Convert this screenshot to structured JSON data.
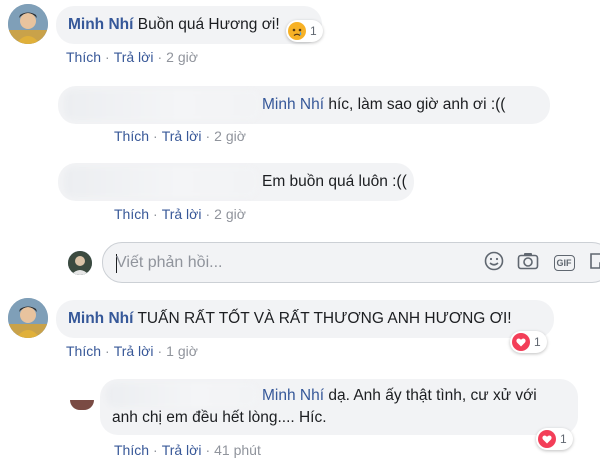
{
  "comments": [
    {
      "author": "Minh Nhí",
      "text": "Buồn quá Hương ơi!",
      "reaction_count": "1",
      "actions": {
        "like": "Thích",
        "reply": "Trả lời",
        "time": "2 giờ"
      }
    },
    {
      "author": "Minh Nhí",
      "text": "TUẤN RẤT TỐT VÀ RẤT THƯƠNG ANH HƯƠNG ƠI!",
      "reaction_count": "1",
      "actions": {
        "like": "Thích",
        "reply": "Trả lời",
        "time": "1 giờ"
      }
    }
  ],
  "replies": [
    {
      "tag": "Minh Nhí",
      "text": "híc, làm sao giờ anh ơi :((",
      "actions": {
        "like": "Thích",
        "reply": "Trả lời",
        "time": "2 giờ"
      }
    },
    {
      "text": "Em buồn quá luôn :((",
      "actions": {
        "like": "Thích",
        "reply": "Trả lời",
        "time": "2 giờ"
      }
    },
    {
      "tag": "Minh Nhí",
      "text_line1": "dạ. Anh ấy thật tình, cư xử với",
      "text_line2": "anh chị em đều hết lòng.... Híc.",
      "reaction_count": "1",
      "actions": {
        "like": "Thích",
        "reply": "Trả lời",
        "time": "41 phút"
      }
    }
  ],
  "reply_input": {
    "placeholder": "Viết phản hồi..."
  },
  "tools": {
    "gif_label": "GIF"
  },
  "colors": {
    "link": "#385898",
    "meta": "#90949c",
    "bubble": "#f2f3f5",
    "love": "#f33e58",
    "sad": "#f7b125"
  },
  "icons": [
    "sad-reaction-icon",
    "love-reaction-icon",
    "emoji-icon",
    "camera-icon",
    "gif-icon",
    "sticker-icon"
  ]
}
